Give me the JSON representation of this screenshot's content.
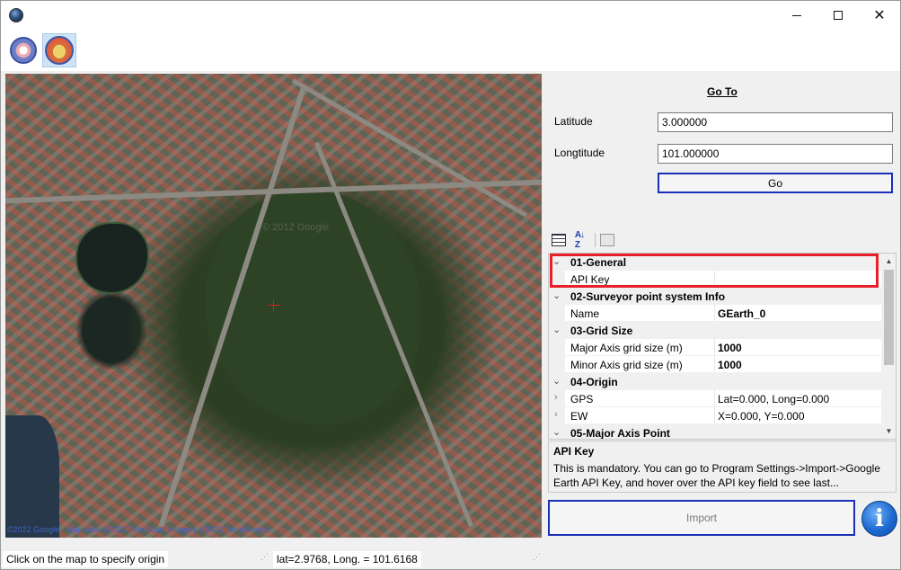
{
  "window": {
    "title": "",
    "controls": {
      "minimize": "minimize",
      "maximize": "maximize",
      "close": "✕"
    }
  },
  "toolbar": {
    "buttons": [
      {
        "icon": "program-settings-icon"
      },
      {
        "icon": "google-earth-icon",
        "active": true
      }
    ]
  },
  "map": {
    "credit": "©2022 Google · Map data ©2022 Tele Atlas, Imagery ©2022 TerraMetrics",
    "watermark": "© 2012 Google"
  },
  "goto": {
    "title": "Go To",
    "latitude_label": "Latitude",
    "latitude_value": "3.000000",
    "longitude_label": "Longtitude",
    "longitude_value": "101.000000",
    "go_label": "Go"
  },
  "property_grid": {
    "categories": [
      {
        "label": "01-General",
        "props": [
          {
            "name": "API Key",
            "value": ""
          }
        ]
      },
      {
        "label": "02-Surveyor point system Info",
        "props": [
          {
            "name": "Name",
            "value": "GEarth_0"
          }
        ]
      },
      {
        "label": "03-Grid Size",
        "props": [
          {
            "name": "Major Axis grid size (m)",
            "value": "1000"
          },
          {
            "name": "Minor Axis grid size (m)",
            "value": "1000"
          }
        ]
      },
      {
        "label": "04-Origin",
        "props": [
          {
            "name": "GPS",
            "value": "Lat=0.000, Long=0.000"
          },
          {
            "name": "EW",
            "value": "X=0.000, Y=0.000"
          }
        ]
      },
      {
        "label": "05-Major Axis Point",
        "props": []
      }
    ],
    "help_title": "API Key",
    "help_text": "This is mandatory. You can go to Program Settings->Import->Google Earth API Key, and hover over the API key field to see last..."
  },
  "actions": {
    "import_label": "Import",
    "info_glyph": "i"
  },
  "status": {
    "hint": "Click on the map to specify origin",
    "coords": "lat=2.9768, Long. = 101.6168"
  },
  "colors": {
    "accent_border": "#1a2fb8",
    "highlight_red": "#e8202a",
    "crosshair": "#e01a1a"
  }
}
